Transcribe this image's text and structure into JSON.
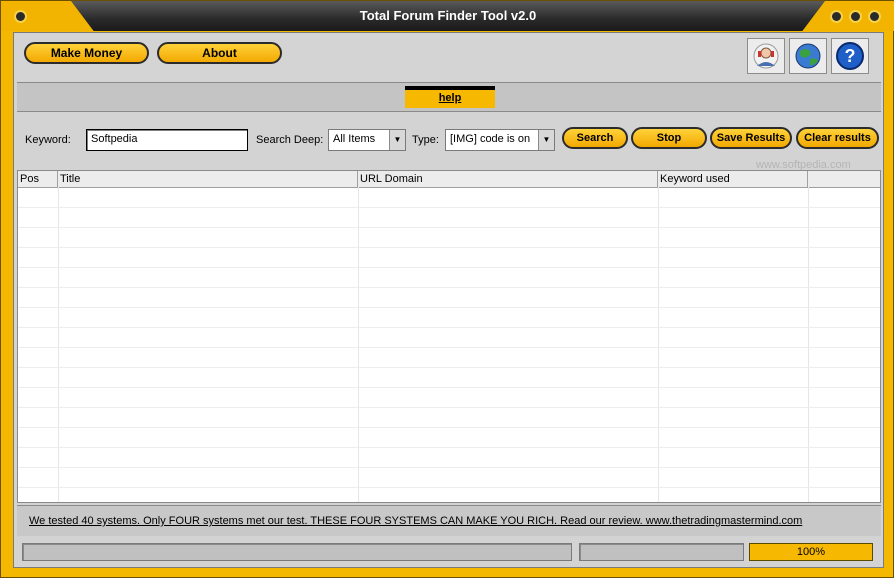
{
  "window": {
    "title": "Total Forum Finder Tool v2.0"
  },
  "toolbar": {
    "make_money_label": "Make Money",
    "about_label": "About",
    "icons": [
      "support-agent-icon",
      "globe-icon",
      "help-question-icon"
    ]
  },
  "help": {
    "label": "help"
  },
  "search": {
    "keyword_label": "Keyword:",
    "keyword_value": "Softpedia",
    "deep_label": "Search Deep:",
    "deep_value": "All Items",
    "type_label": "Type:",
    "type_value": "[IMG] code is on",
    "search_label": "Search",
    "stop_label": "Stop",
    "save_label": "Save Results",
    "clear_label": "Clear results"
  },
  "table": {
    "columns": [
      "Pos",
      "Title",
      "URL Domain",
      "Keyword used"
    ],
    "rows": []
  },
  "promo": {
    "text": "We tested 40 systems. Only FOUR systems met our test. THESE FOUR SYSTEMS CAN MAKE YOU RICH. Read our review. www.thetradingmastermind.com"
  },
  "status": {
    "progress_text": "100%",
    "progress_value": 1.0
  },
  "watermark": {
    "text": "www.softpedia.com"
  },
  "colors": {
    "accent": "#f5b800",
    "frame": "#2a2a2a",
    "panel": "#d3d3d3"
  }
}
